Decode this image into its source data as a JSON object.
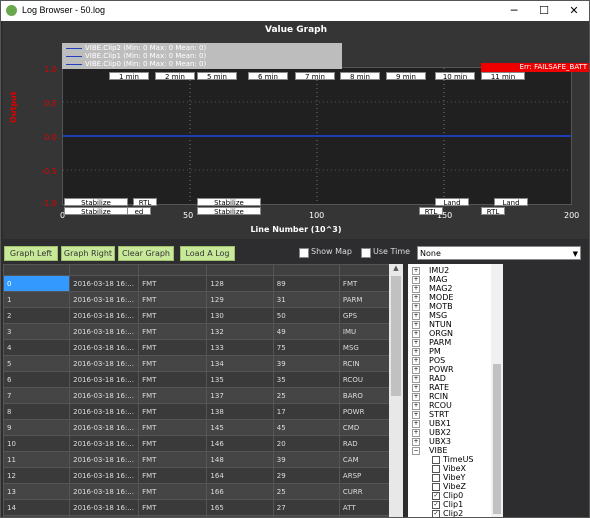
{
  "window": {
    "title": "Log Browser - 50.log",
    "minimize": "─",
    "maximize": "☐",
    "close": "✕"
  },
  "graph": {
    "title": "Value Graph",
    "legend": [
      "VIBE.Clip2 (Min: 0 Max: 0 Mean: 0)",
      "VIBE.Clip1 (Min: 0 Max: 0 Mean: 0)",
      "VIBE.Clip0 (Min: 0 Max: 0 Mean: 0)"
    ],
    "ylabel": "Output",
    "xlabel": "Line Number (10^3)",
    "yticks": [
      "1.0",
      "0.5",
      "0.0",
      "-0.5",
      "-1.0"
    ],
    "xticks": [
      "0",
      "50",
      "100",
      "150",
      "200"
    ],
    "time_markers": [
      "1 min",
      "2 min",
      "5 min",
      "6 min",
      "7 min",
      "8 min",
      "9 min",
      "10 min",
      "11 min"
    ],
    "error_label": "Err: FAILSAFE_BATT",
    "events_top": [
      "Stabilize",
      "RTL",
      "Stabilize",
      "Land",
      "Land"
    ],
    "events_bottom": [
      "Stabilize",
      "ed",
      "Stabilize",
      "RTL",
      "RTL"
    ]
  },
  "chart_data": {
    "type": "line",
    "title": "Value Graph",
    "xlabel": "Line Number (10^3)",
    "ylabel": "Output",
    "xlim": [
      0,
      200
    ],
    "ylim": [
      -1,
      1
    ],
    "series": [
      {
        "name": "VIBE.Clip2",
        "x": [
          0,
          200
        ],
        "values": [
          0,
          0
        ]
      },
      {
        "name": "VIBE.Clip1",
        "x": [
          0,
          200
        ],
        "values": [
          0,
          0
        ]
      },
      {
        "name": "VIBE.Clip0",
        "x": [
          0,
          200
        ],
        "values": [
          0,
          0
        ]
      }
    ],
    "line_color": "#1f3fbf",
    "grid": true
  },
  "toolbar": {
    "graph_left": "Graph Left",
    "graph_right": "Graph Right",
    "clear_graph": "Clear Graph",
    "load_log": "Load A Log",
    "show_map": "Show Map",
    "use_time": "Use Time",
    "combo_value": "None"
  },
  "table": {
    "rows": [
      [
        "0",
        "2016-03-18 16:...",
        "FMT",
        "128",
        "89",
        "FMT"
      ],
      [
        "1",
        "2016-03-18 16:...",
        "FMT",
        "129",
        "31",
        "PARM"
      ],
      [
        "2",
        "2016-03-18 16:...",
        "FMT",
        "130",
        "50",
        "GPS"
      ],
      [
        "3",
        "2016-03-18 16:...",
        "FMT",
        "132",
        "49",
        "IMU"
      ],
      [
        "4",
        "2016-03-18 16:...",
        "FMT",
        "133",
        "75",
        "MSG"
      ],
      [
        "5",
        "2016-03-18 16:...",
        "FMT",
        "134",
        "39",
        "RCIN"
      ],
      [
        "6",
        "2016-03-18 16:...",
        "FMT",
        "135",
        "35",
        "RCOU"
      ],
      [
        "7",
        "2016-03-18 16:...",
        "FMT",
        "137",
        "25",
        "BARO"
      ],
      [
        "8",
        "2016-03-18 16:...",
        "FMT",
        "138",
        "17",
        "POWR"
      ],
      [
        "9",
        "2016-03-18 16:...",
        "FMT",
        "145",
        "45",
        "CMD"
      ],
      [
        "10",
        "2016-03-18 16:...",
        "FMT",
        "146",
        "20",
        "RAD"
      ],
      [
        "11",
        "2016-03-18 16:...",
        "FMT",
        "148",
        "39",
        "CAM"
      ],
      [
        "12",
        "2016-03-18 16:...",
        "FMT",
        "164",
        "29",
        "ARSP"
      ],
      [
        "13",
        "2016-03-18 16:...",
        "FMT",
        "166",
        "25",
        "CURR"
      ],
      [
        "14",
        "2016-03-18 16:...",
        "FMT",
        "165",
        "27",
        "ATT"
      ],
      [
        "15",
        "2016-03-18 16:...",
        "FMT",
        "167",
        "30",
        "MAG"
      ]
    ]
  },
  "tree": {
    "groups": [
      "IMU2",
      "MAG",
      "MAG2",
      "MODE",
      "MOTB",
      "MSG",
      "NTUN",
      "ORGN",
      "PARM",
      "PM",
      "POS",
      "POWR",
      "RAD",
      "RATE",
      "RCIN",
      "RCOU",
      "STRT",
      "UBX1",
      "UBX2",
      "UBX3",
      "VIBE"
    ],
    "children": [
      {
        "label": "TimeUS",
        "checked": false
      },
      {
        "label": "VibeX",
        "checked": false
      },
      {
        "label": "VibeY",
        "checked": false
      },
      {
        "label": "VibeZ",
        "checked": false
      },
      {
        "label": "Clip0",
        "checked": true
      },
      {
        "label": "Clip1",
        "checked": true
      },
      {
        "label": "Clip2",
        "checked": true
      }
    ]
  }
}
